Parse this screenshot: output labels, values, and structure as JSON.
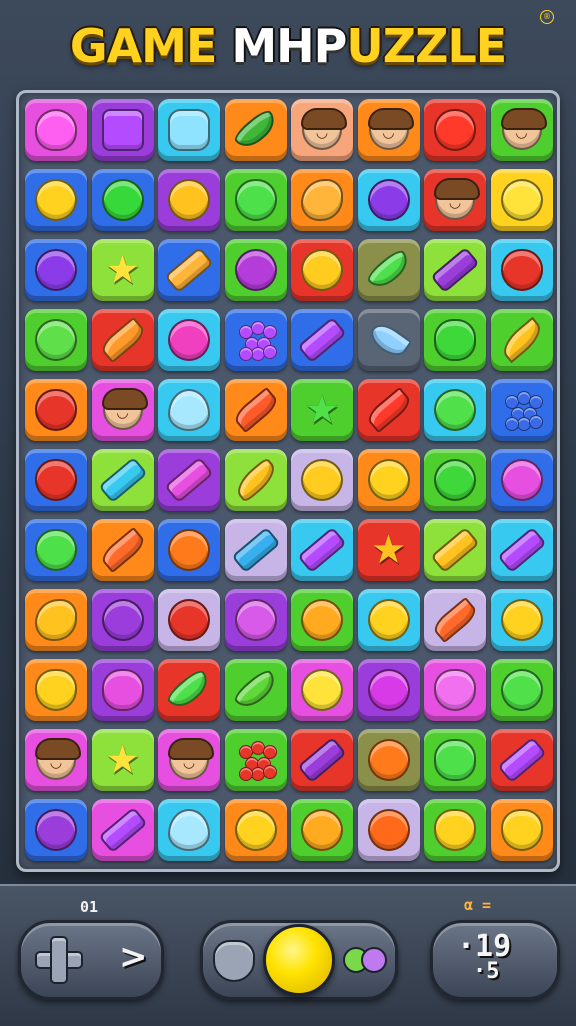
{
  "title": {
    "left": "GAME ",
    "mid": "MHP",
    "right": "UZZLE",
    "reg": "®"
  },
  "colors": {
    "pink": "#e64fe0",
    "purple": "#9a3ddb",
    "cyan": "#38c9f0",
    "orange": "#ff8a1a",
    "red": "#e8352a",
    "green": "#4fcf2e",
    "blue": "#2f6ee8",
    "yellow": "#ffd21f",
    "lime": "#8ee03a",
    "lavender": "#c7b5e8",
    "olive": "#8a8f4a",
    "grey": "#596574",
    "peach": "#f7a57a"
  },
  "board": [
    [
      [
        "pink",
        "candy-icon",
        "#ff5ff0"
      ],
      [
        "purple",
        "gem-icon",
        "#b44bff"
      ],
      [
        "cyan",
        "crystal-icon",
        "#8fe3ff"
      ],
      [
        "orange",
        "pepper-icon",
        "#3fb83a"
      ],
      [
        "peach",
        "face-icon",
        "#f2c49a"
      ],
      [
        "orange",
        "face-icon",
        "#f2c49a"
      ],
      [
        "red",
        "apple-icon",
        "#ff3a2a"
      ],
      [
        "green",
        "face-icon",
        "#f2c49a"
      ]
    ],
    [
      [
        "blue",
        "lemon-icon",
        "#ffd21f"
      ],
      [
        "blue",
        "lime-icon",
        "#37d83a"
      ],
      [
        "purple",
        "orange-icon",
        "#ffc21f"
      ],
      [
        "green",
        "apple-icon",
        "#4ee04a"
      ],
      [
        "orange",
        "mango-icon",
        "#ffb43a"
      ],
      [
        "cyan",
        "planet-icon",
        "#8b3ce8"
      ],
      [
        "red",
        "face-icon",
        "#f2c49a"
      ],
      [
        "yellow",
        "lemon-icon",
        "#ffe23a"
      ]
    ],
    [
      [
        "blue",
        "plum-icon",
        "#8b3ce8"
      ],
      [
        "lime",
        "star-icon",
        "#ffe23a"
      ],
      [
        "blue",
        "bow-icon",
        "#ffb43a"
      ],
      [
        "green",
        "grape-icon",
        "#b43cd8"
      ],
      [
        "red",
        "orange-icon",
        "#ffcc1f"
      ],
      [
        "olive",
        "pepper-icon",
        "#4ee04a"
      ],
      [
        "lime",
        "candy-bar-icon",
        "#9a3ddb"
      ],
      [
        "cyan",
        "apple-icon",
        "#e8352a"
      ]
    ],
    [
      [
        "green",
        "lime-icon",
        "#5fe04a"
      ],
      [
        "red",
        "carrot-icon",
        "#ff9a2a"
      ],
      [
        "cyan",
        "ball-icon",
        "#f040c0"
      ],
      [
        "blue",
        "berries-icon",
        "#b44bff"
      ],
      [
        "blue",
        "crystal-bar-icon",
        "#b44bff"
      ],
      [
        "grey",
        "fish-icon",
        "#8fd0ff"
      ],
      [
        "green",
        "melon-icon",
        "#3fd83a"
      ],
      [
        "green",
        "leaf-icon",
        "#ffc21f"
      ]
    ],
    [
      [
        "orange",
        "apple-icon",
        "#e8352a"
      ],
      [
        "pink",
        "face-icon",
        "#f2c49a"
      ],
      [
        "cyan",
        "drop-icon",
        "#a8e8ff"
      ],
      [
        "orange",
        "carrot-icon",
        "#ff5a2a"
      ],
      [
        "green",
        "star-icon",
        "#4fe04a"
      ],
      [
        "red",
        "carrot-icon",
        "#ff3a2a"
      ],
      [
        "cyan",
        "lime-icon",
        "#4fe04a"
      ],
      [
        "blue",
        "berries-icon",
        "#3a6ae8"
      ]
    ],
    [
      [
        "blue",
        "apple-icon",
        "#e8352a"
      ],
      [
        "lime",
        "crystal-bar-icon",
        "#38c9f0"
      ],
      [
        "purple",
        "crystal-bar-icon",
        "#e64fe0"
      ],
      [
        "lime",
        "banana-icon",
        "#ffc21f"
      ],
      [
        "lavender",
        "orange-icon",
        "#ffcc1f"
      ],
      [
        "orange",
        "lemon-icon",
        "#ffd21f"
      ],
      [
        "green",
        "lime-icon",
        "#3fd83a"
      ],
      [
        "blue",
        "ball-icon",
        "#e64fe0"
      ]
    ],
    [
      [
        "blue",
        "apple-icon",
        "#4ee04a"
      ],
      [
        "orange",
        "carrot-icon",
        "#ff6a2a"
      ],
      [
        "blue",
        "cherry-icon",
        "#ff7a1a"
      ],
      [
        "lavender",
        "crystal-bar-icon",
        "#38b0f0"
      ],
      [
        "cyan",
        "crystal-bar-icon",
        "#b44bff"
      ],
      [
        "red",
        "star-icon",
        "#ffc21f"
      ],
      [
        "lime",
        "crystal-bar-icon",
        "#ffc21f"
      ],
      [
        "cyan",
        "crystal-bar-icon",
        "#b44bff"
      ]
    ],
    [
      [
        "orange",
        "mango-icon",
        "#ffc21f"
      ],
      [
        "purple",
        "plum-icon",
        "#9a3ddb"
      ],
      [
        "lavender",
        "ball-icon",
        "#e8352a"
      ],
      [
        "purple",
        "grape-icon",
        "#d85ae8"
      ],
      [
        "green",
        "orange-icon",
        "#ffaa1f"
      ],
      [
        "cyan",
        "lemon-icon",
        "#ffd21f"
      ],
      [
        "lavender",
        "carrot-icon",
        "#ff6a2a"
      ],
      [
        "cyan",
        "lemon-icon",
        "#ffd21f"
      ]
    ],
    [
      [
        "orange",
        "heart-icon",
        "#ffd21f"
      ],
      [
        "purple",
        "raspberry-icon",
        "#e64fe0"
      ],
      [
        "red",
        "pepper-icon",
        "#4ee04a"
      ],
      [
        "green",
        "pepper-icon",
        "#5fd83a"
      ],
      [
        "pink",
        "lemon-icon",
        "#ffe23a"
      ],
      [
        "purple",
        "ball-icon",
        "#d83ae8"
      ],
      [
        "pink",
        "heart-icon",
        "#f070f0"
      ],
      [
        "green",
        "lime-icon",
        "#4fe04a"
      ]
    ],
    [
      [
        "pink",
        "face-icon",
        "#f2c49a"
      ],
      [
        "lime",
        "star-icon",
        "#ffe23a"
      ],
      [
        "pink",
        "face-icon",
        "#f2c49a"
      ],
      [
        "green",
        "cherries-icon",
        "#e8352a"
      ],
      [
        "red",
        "candy-bar-icon",
        "#9a3ddb"
      ],
      [
        "olive",
        "orange-ball-icon",
        "#ff7a1a"
      ],
      [
        "green",
        "melon-icon",
        "#4ee04a"
      ],
      [
        "red",
        "candy-bar-icon",
        "#b44bff"
      ]
    ],
    [
      [
        "blue",
        "plum-icon",
        "#9a3ddb"
      ],
      [
        "pink",
        "candy-bar-icon",
        "#b44bff"
      ],
      [
        "cyan",
        "drop-icon",
        "#a8e8ff"
      ],
      [
        "orange",
        "lemon-icon",
        "#ffd21f"
      ],
      [
        "green",
        "orange-icon",
        "#ffaa1f"
      ],
      [
        "lavender",
        "ball-icon",
        "#ff6a1a"
      ],
      [
        "green",
        "heart-icon",
        "#ffd21f"
      ],
      [
        "orange",
        "heart-icon",
        "#ffd21f"
      ]
    ]
  ],
  "hud": {
    "left_label": "01",
    "right_label": "α =",
    "score_top": "·19",
    "score_bottom": "·5"
  }
}
